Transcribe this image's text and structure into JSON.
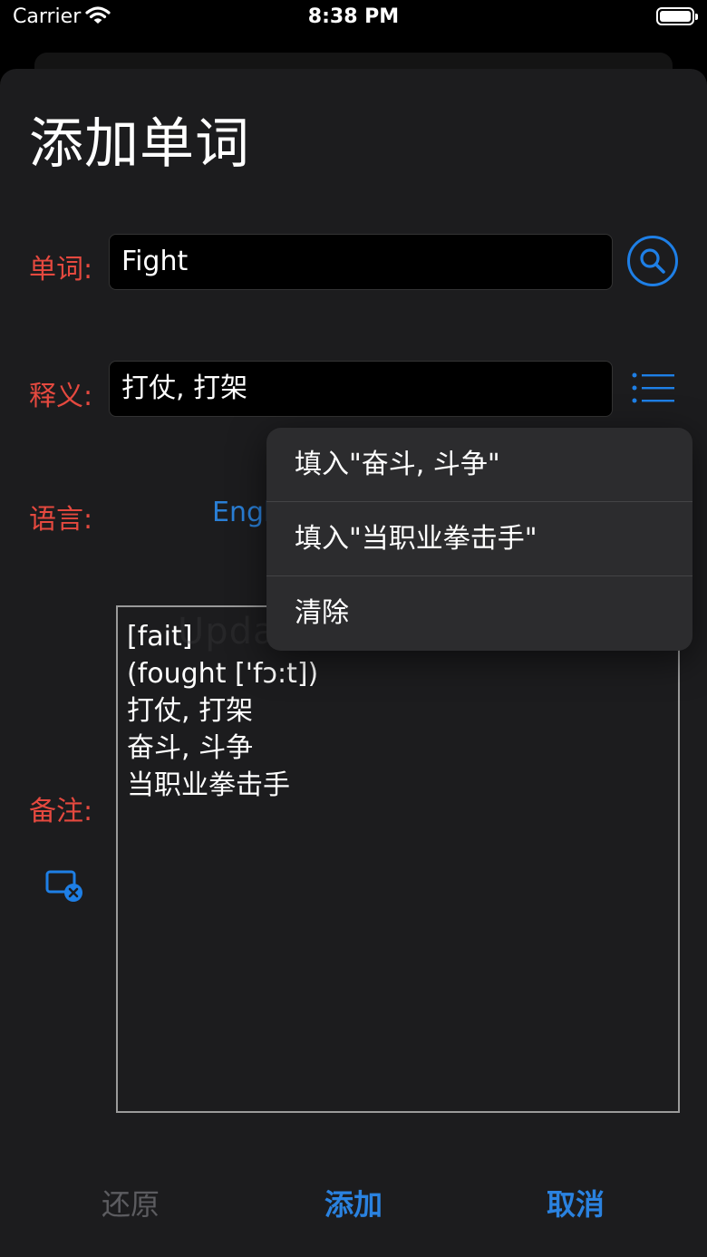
{
  "status_bar": {
    "carrier": "Carrier",
    "time": "8:38 PM"
  },
  "sheet": {
    "title": "添加单词"
  },
  "form": {
    "word_label": "单词:",
    "word_value": "Fight",
    "meaning_label": "释义:",
    "meaning_value": "打仗, 打架",
    "language_label": "语言:",
    "language_value": "Engl",
    "notes_label": "备注:",
    "notes_value": "[fait]\n(fought ['fɔ:t])\n打仗, 打架\n奋斗, 斗争\n当职业拳击手",
    "watermark": "UpdateStar.com"
  },
  "menu": {
    "items": [
      {
        "label": "填入\"奋斗, 斗争\""
      },
      {
        "label": "填入\"当职业拳击手\""
      },
      {
        "label": "清除"
      }
    ]
  },
  "buttons": {
    "restore": "还原",
    "add": "添加",
    "cancel": "取消"
  },
  "colors": {
    "accent": "#1e7fe6",
    "label": "#e5493f",
    "background": "#1c1c1e"
  },
  "icons": {
    "search": "magnifier-icon",
    "list": "list-icon",
    "clear_image": "clear-image-icon"
  }
}
